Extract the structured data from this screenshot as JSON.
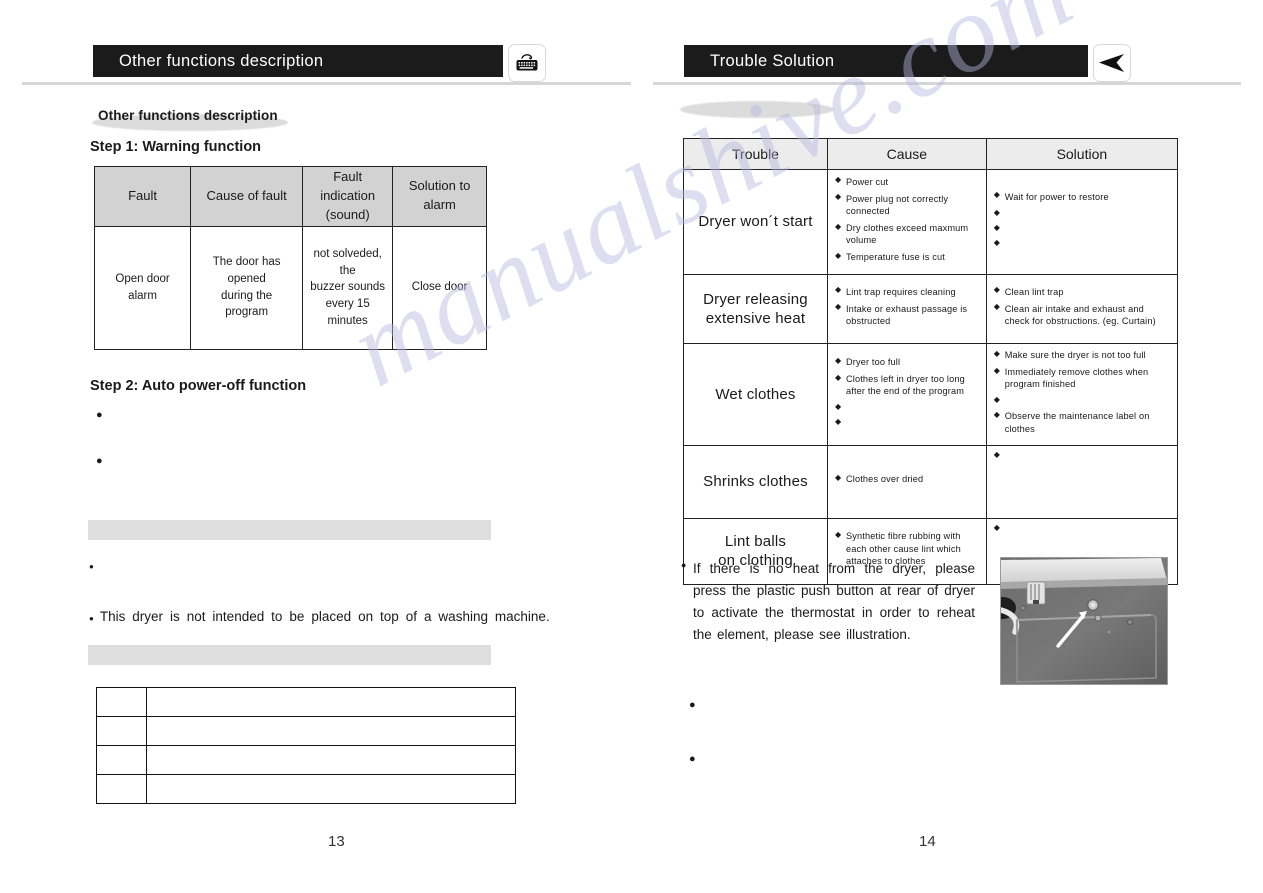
{
  "left_page": {
    "header": {
      "title": "Other functions description",
      "icon": "control-panel-keyboard-icon"
    },
    "subheading": "Other functions description",
    "step1": {
      "title": "Step 1:  Warning function",
      "table": {
        "headers": [
          "Fault",
          "Cause of fault",
          "Fault indication\n(sound)",
          "Solution to\nalarm"
        ],
        "header_line1": [
          "Fault",
          "Cause of fault",
          "Fault  indication",
          "Solution to"
        ],
        "header_line2": [
          "",
          "",
          "(sound)",
          "alarm"
        ],
        "rows": [
          {
            "fault": "Open door\nalarm",
            "cause": "The door has opened\nduring the program",
            "indication": "not solveded, the\nbuzzer sounds\nevery 15 minutes",
            "solution": "Close door"
          }
        ]
      }
    },
    "step2": {
      "title": "Step 2:  Auto power-off function",
      "bullets": [
        "",
        ""
      ]
    },
    "notice_bar_1": "",
    "notice_bullets": [
      "",
      "This dryer is not intended to be placed on top of a washing machine."
    ],
    "notice_bar_2": "",
    "blank_table": {
      "rows": [
        [
          "",
          ""
        ],
        [
          "",
          ""
        ],
        [
          "",
          ""
        ],
        [
          "",
          ""
        ]
      ]
    },
    "page_number": "13"
  },
  "right_page": {
    "header": {
      "title": "Trouble  Solution",
      "icon": "arrow-dart-left-icon"
    },
    "subheading": "",
    "trouble_table": {
      "headers": [
        "Trouble",
        "Cause",
        "Solution"
      ],
      "rows": [
        {
          "trouble": "Dryer  won´t  start",
          "causes": [
            "Power cut",
            "Power plug not correctly connected",
            "Dry clothes exceed maxmum volume",
            "Temperature fuse is cut"
          ],
          "solutions": [
            "Wait  for  power  to  restore",
            "",
            "",
            ""
          ]
        },
        {
          "trouble": "Dryer  releasing\nextensive  heat",
          "causes": [
            "Lint  trap  requires  cleaning",
            "Intake  or  exhaust  passage  is obstructed"
          ],
          "solutions": [
            "Clean  lint  trap",
            "Clean air intake and exhaust and check for obstructions. (eg. Curtain)"
          ]
        },
        {
          "trouble": "Wet  clothes",
          "causes": [
            "Dryer  too full",
            "Clothes  left  in  dryer  too  long after  the  end  of  the  program",
            "",
            ""
          ],
          "solutions": [
            "Make  sure  the  dryer  is  not  too  full",
            "Immediately  remove  clothes  when program  finished",
            "",
            "Observe  the  maintenance  label  on  clothes"
          ]
        },
        {
          "trouble": "Shrinks  clothes",
          "causes": [
            "Clothes  over  dried"
          ],
          "solutions": [
            ""
          ]
        },
        {
          "trouble": "Lint  balls\non  clothing",
          "causes": [
            "Synthetic  fibre  rubbing  with  each other  cause  lint  which  attaches to  clothes"
          ],
          "solutions": [
            ""
          ]
        }
      ]
    },
    "note_paragraph": "If there is no heat from the dryer, please press the plastic push button at rear of dryer to activate the thermostat in order to reheat the element, please see illustration.",
    "photo_caption": "dryer-rear-panel-push-button-photo",
    "extra_bullets": [
      "",
      ""
    ],
    "page_number": "14"
  },
  "watermark": "manualshive.com",
  "colors": {
    "header_bar": "#1b1b1b",
    "table_header_gray": "#d2d2d2",
    "trouble_header_gray": "#ececec",
    "rule": "#d6d6d6",
    "gray_bar": "#dedede",
    "watermark": "#b9b6e0"
  }
}
